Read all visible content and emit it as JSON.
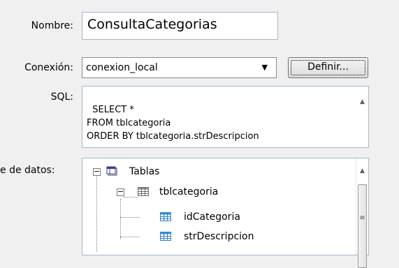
{
  "form": {
    "name_label": "Nombre:",
    "name_value": "ConsultaCategorias",
    "connection_label": "Conexión:",
    "connection_value": "conexion_local",
    "define_button": "Definir...",
    "sql_label": "SQL:",
    "sql_value": "SELECT *\nFROM tblcategoria\nORDER BY tblcategoria.strDescripcion",
    "datasource_label": "e de datos:"
  },
  "tree": {
    "root": {
      "label": "Tablas",
      "icon": "database-icon",
      "expanded": true
    },
    "table": {
      "label": "tblcategoria",
      "icon": "table-icon",
      "expanded": true
    },
    "fields": [
      {
        "label": "idCategoria",
        "icon": "field-icon"
      },
      {
        "label": "strDescripcion",
        "icon": "field-icon"
      }
    ]
  },
  "colors": {
    "background": "#f0f0f0",
    "field_border": "#a8b5c6",
    "table_icon": "#9a9a9a",
    "field_icon": "#3a8fd8"
  }
}
